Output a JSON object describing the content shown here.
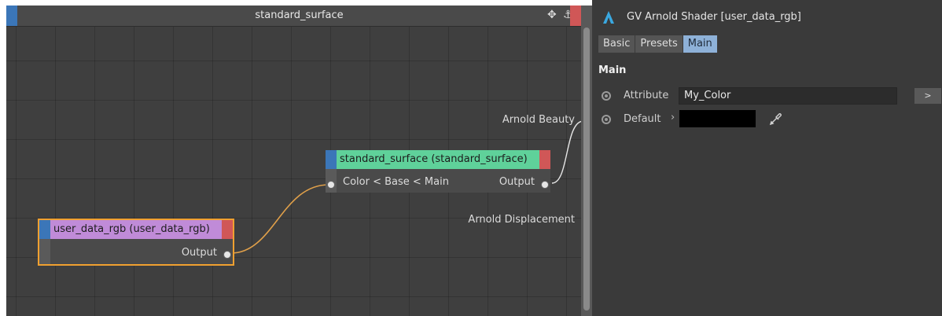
{
  "editor": {
    "title": "standard_surface",
    "nodes": {
      "standard_surface": {
        "title": "standard_surface (standard_surface)",
        "input_label": "Color < Base < Main",
        "output_label": "Output",
        "color": "#5fd19a"
      },
      "user_data_rgb": {
        "title": "user_data_rgb (user_data_rgb)",
        "output_label": "Output",
        "color": "#c08bd8"
      }
    },
    "material_ports": {
      "beauty": "Arnold Beauty",
      "displacement": "Arnold Displacement"
    }
  },
  "attributes": {
    "title": "GV Arnold Shader [user_data_rgb]",
    "tabs": [
      "Basic",
      "Presets",
      "Main"
    ],
    "active_tab": "Main",
    "section": "Main",
    "attribute_label": "Attribute",
    "attribute_value": "My_Color",
    "expand_button": ">",
    "default_label": "Default",
    "default_color": "#000000"
  },
  "colors": {
    "wire": "#e0a04a",
    "selection": "#f0a030",
    "accent_blue": "#3b76b8",
    "accent_red": "#d05757"
  }
}
